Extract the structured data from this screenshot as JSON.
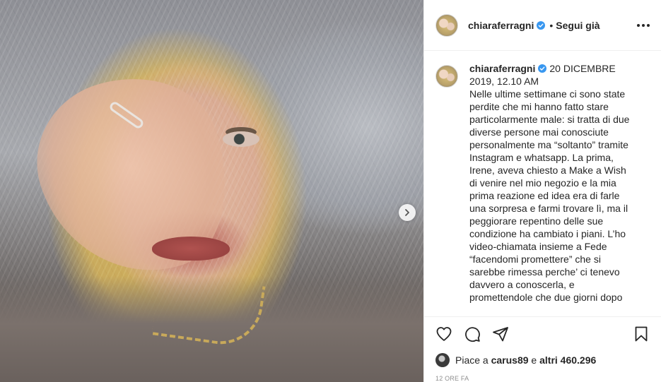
{
  "header": {
    "username": "chiaraferragni",
    "separator": "•",
    "follow_status": "Segui già"
  },
  "caption": {
    "username": "chiaraferragni",
    "date": "20 DICEMBRE 2019, 12.10 AM",
    "text": "Nelle ultime settimane ci sono state perdite che mi hanno fatto stare particolarmente male: si tratta di due diverse persone mai conosciute personalmente ma “soltanto” tramite Instagram e whatsapp. La prima, Irene, aveva chiesto a Make a Wish di venire nel mio negozio e la mia prima reazione ed idea era di farle una sorpresa e farmi trovare lì, ma il peggiorare repentino delle sue condizione ha cambiato i piani. L’ho video-chiamata insieme a Fede “facendomi promettere” che si sarebbe rimessa perche’ ci tenevo davvero a conoscerla, e promettendole che due giorni dopo"
  },
  "likes": {
    "prefix": "Piace a ",
    "first_user": "carus89",
    "middle": " e ",
    "others": "altri 460.296"
  },
  "timestamp": "12 ORE FA",
  "icons": {
    "verified": "verified-badge-icon",
    "more": "more-options-icon",
    "like": "heart-icon",
    "comment": "comment-icon",
    "share": "share-icon",
    "save": "bookmark-icon",
    "next": "chevron-right-icon"
  },
  "colors": {
    "verified_blue": "#3897f0",
    "text": "#262626",
    "muted": "#8e8e8e",
    "border": "#efefef"
  }
}
